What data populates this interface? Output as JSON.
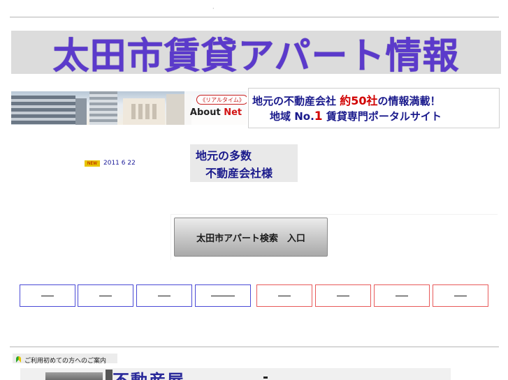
{
  "header": {
    "dot": "·",
    "site_title": "太田市賃貸アパート情報"
  },
  "photo_banner": {
    "realtime_badge": "《リアルタイム》",
    "logo_about": "About ",
    "logo_net": "Net"
  },
  "tagline": {
    "line1_prefix": "地元の不動産会社 ",
    "line1_highlight": "約50社",
    "line1_suffix": "の情報満載！",
    "line2_prefix": "地域 No.",
    "line2_highlight": "1",
    "line2_suffix": " 賃貸専門ポータルサイト"
  },
  "news": {
    "new_badge": "NEW",
    "date": "2011 6 22"
  },
  "local_box": {
    "line1": "地元の多数",
    "line2": "不動産会社様"
  },
  "search": {
    "button_label": "太田市アパート検索　入口"
  },
  "nav": {
    "items": [
      {
        "color": "blue"
      },
      {
        "color": "blue"
      },
      {
        "color": "blue"
      },
      {
        "color": "blue"
      },
      {
        "color": "red"
      },
      {
        "color": "red"
      },
      {
        "color": "red"
      },
      {
        "color": "red"
      }
    ]
  },
  "guide": {
    "icon": "leaf-icon",
    "text": "ご利用初めての方へのご案内"
  },
  "bottom_banner": {
    "title": "不動産屋"
  },
  "colors": {
    "title_purple": "#5b3acb",
    "navy_text": "#1a1a8c",
    "highlight_red": "#d10000",
    "nav_blue": "#4a4ad6",
    "nav_red": "#e85a5a"
  }
}
